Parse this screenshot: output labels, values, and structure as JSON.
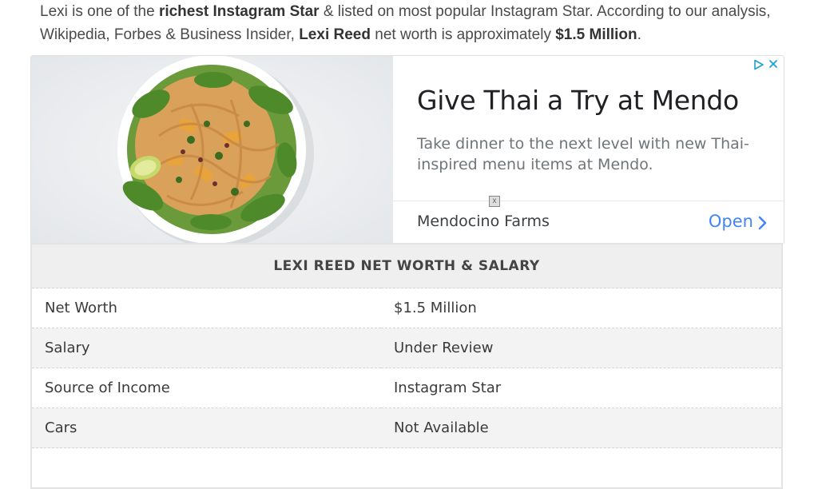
{
  "intro": {
    "p1": "Lexi is one of the ",
    "b1": "richest Instagram Star",
    "p2": " & listed on most popular Instagram Star. According to our analysis, Wikipedia, Forbes & Business Insider, ",
    "b2": "Lexi Reed",
    "p3": " net worth is approximately ",
    "b3": "$1.5 Million",
    "p4": "."
  },
  "ad": {
    "headline": "Give Thai a Try at Mendo",
    "description": "Take dinner to the next level with new Thai-inspired menu items at Mendo.",
    "advertiser": "Mendocino Farms",
    "cta": "Open",
    "mini_close": "x",
    "icons": [
      "adchoices-icon",
      "close-icon",
      "chevron-right-icon"
    ],
    "accent_color": "#4285f4"
  },
  "table": {
    "title": "LEXI REED NET WORTH & SALARY",
    "rows": [
      {
        "label": "Net Worth",
        "value": "$1.5 Million"
      },
      {
        "label": "Salary",
        "value": "Under Review"
      },
      {
        "label": "Source of Income",
        "value": "Instagram Star"
      },
      {
        "label": "Cars",
        "value": "Not Available"
      }
    ]
  }
}
